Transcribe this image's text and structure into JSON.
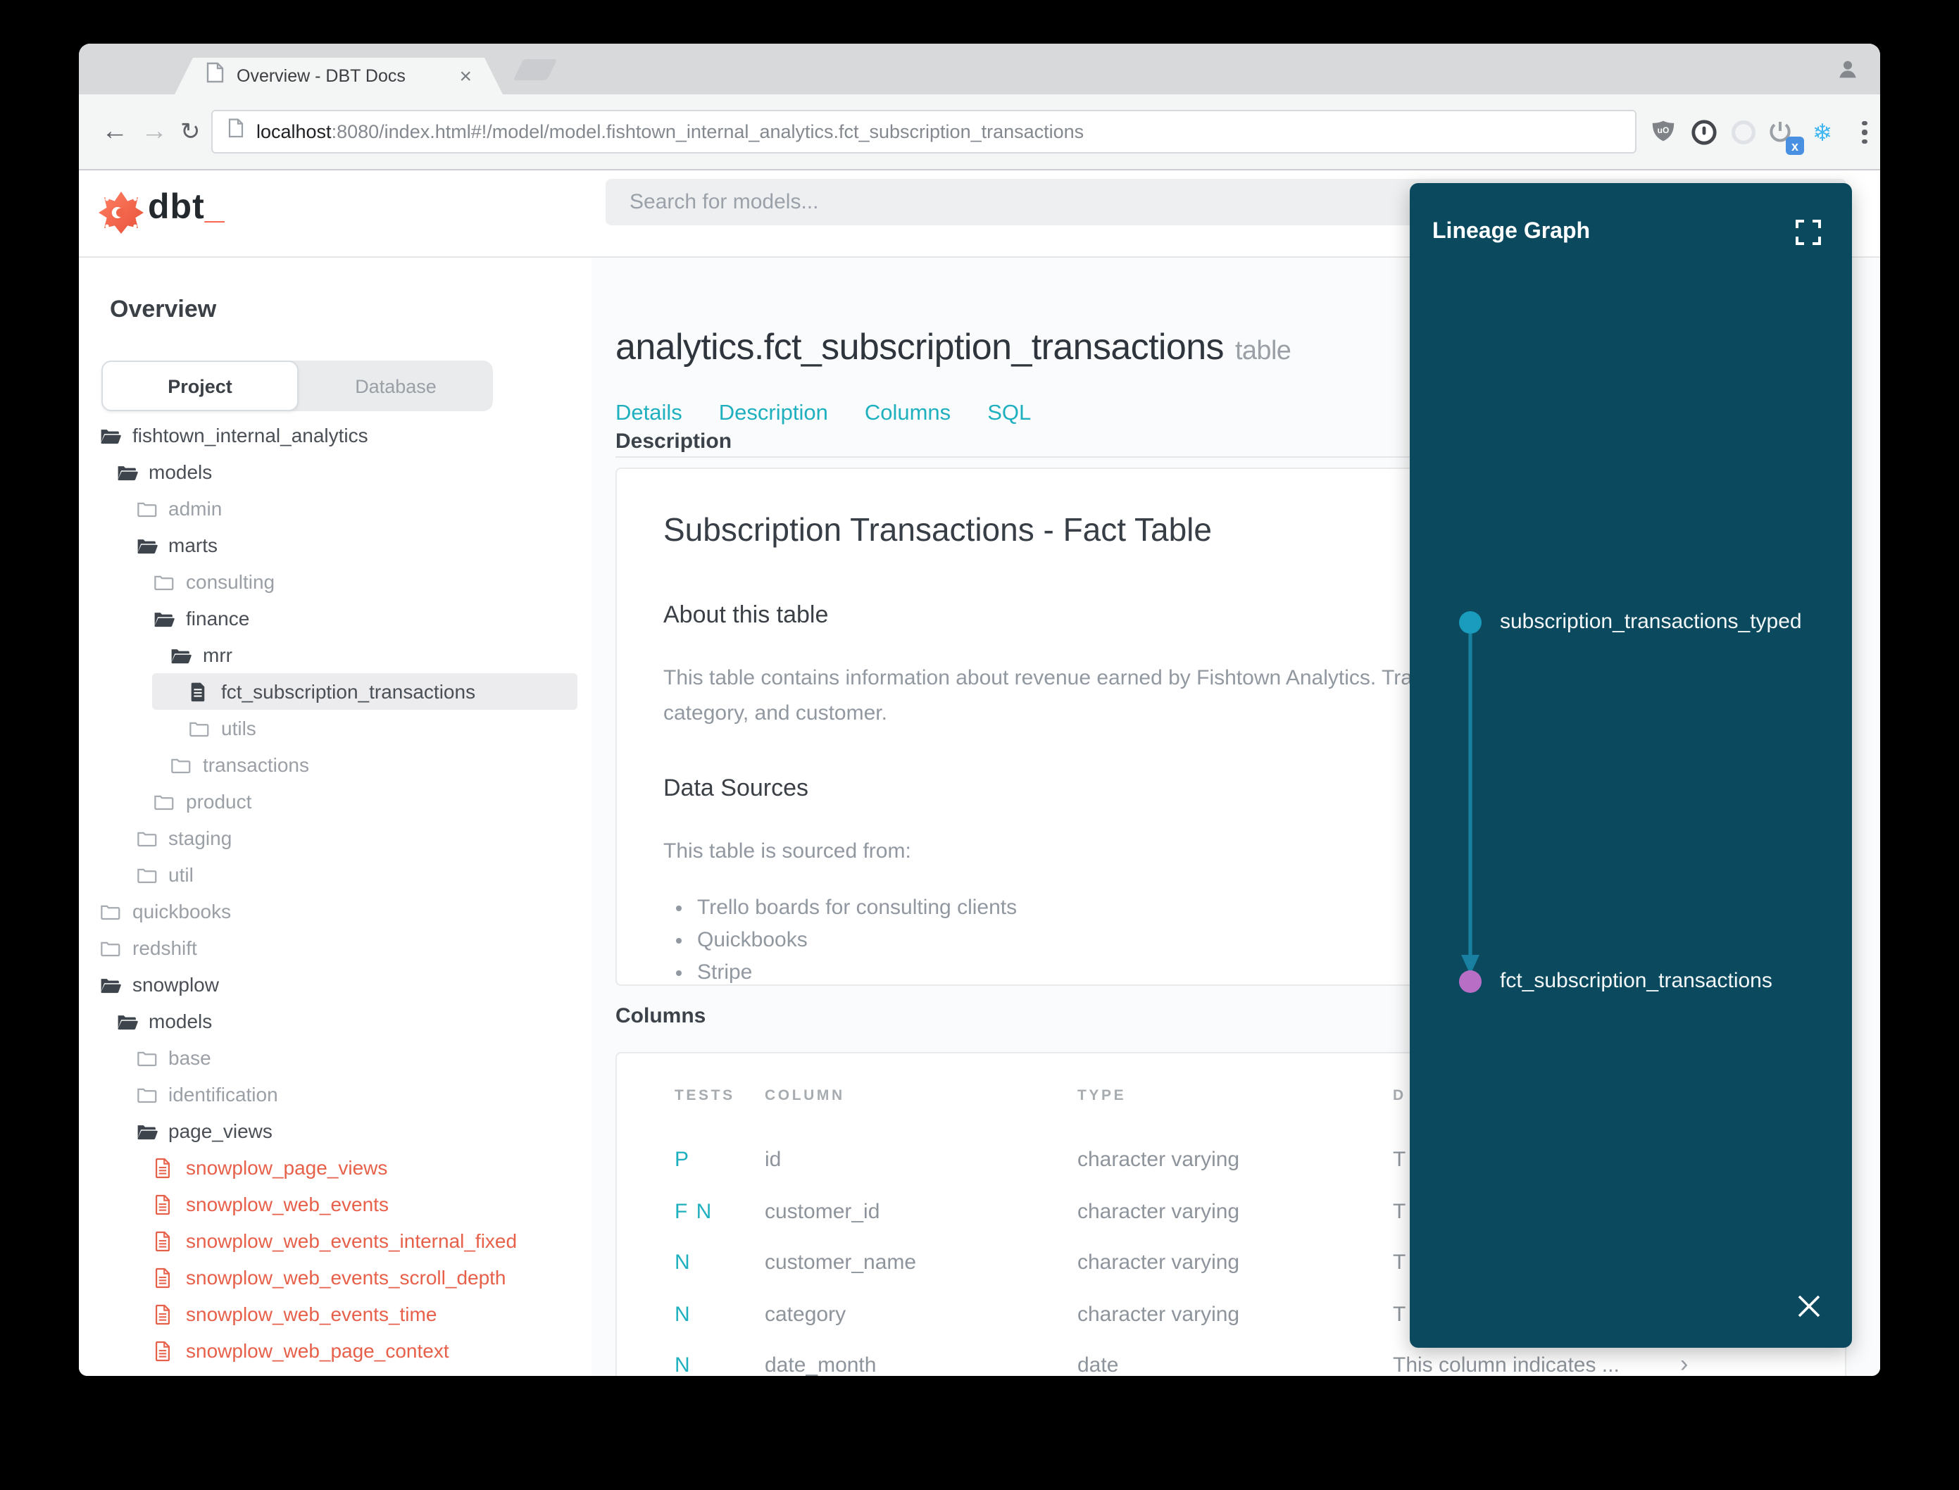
{
  "browser": {
    "tab_title": "Overview - DBT Docs",
    "tab_close": "×",
    "url_host": "localhost",
    "url_rest": ":8080/index.html#!/model/model.fishtown_internal_analytics.fct_subscription_transactions",
    "back_glyph": "←",
    "forward_glyph": "→",
    "reload_glyph": "↻",
    "snowflake_glyph": "❄",
    "extension_badge": "x"
  },
  "app_header": {
    "logo_text": "dbt",
    "logo_cursor": "_",
    "search_placeholder": "Search for models..."
  },
  "sidebar": {
    "heading": "Overview",
    "tabs": [
      {
        "label": "Project",
        "active": true
      },
      {
        "label": "Database",
        "active": false
      }
    ],
    "tree": [
      {
        "label": "fishtown_internal_analytics",
        "level": 0,
        "icon": "folder-open",
        "tone": "dark"
      },
      {
        "label": "models",
        "level": 1,
        "icon": "folder-open",
        "tone": "dark"
      },
      {
        "label": "admin",
        "level": 2,
        "icon": "folder",
        "tone": "gray"
      },
      {
        "label": "marts",
        "level": 2,
        "icon": "folder-open",
        "tone": "dark"
      },
      {
        "label": "consulting",
        "level": 3,
        "icon": "folder",
        "tone": "gray"
      },
      {
        "label": "finance",
        "level": 3,
        "icon": "folder-open",
        "tone": "dark"
      },
      {
        "label": "mrr",
        "level": 4,
        "icon": "folder-open",
        "tone": "dark"
      },
      {
        "label": "fct_subscription_transactions",
        "level": 5,
        "icon": "file-solid",
        "tone": "dark",
        "selected": true
      },
      {
        "label": "utils",
        "level": 5,
        "icon": "folder",
        "tone": "gray"
      },
      {
        "label": "transactions",
        "level": 4,
        "icon": "folder",
        "tone": "gray"
      },
      {
        "label": "product",
        "level": 3,
        "icon": "folder",
        "tone": "gray"
      },
      {
        "label": "staging",
        "level": 2,
        "icon": "folder",
        "tone": "gray"
      },
      {
        "label": "util",
        "level": 2,
        "icon": "folder",
        "tone": "gray"
      },
      {
        "label": "quickbooks",
        "level": 0,
        "icon": "folder",
        "tone": "gray"
      },
      {
        "label": "redshift",
        "level": 0,
        "icon": "folder",
        "tone": "gray"
      },
      {
        "label": "snowplow",
        "level": 0,
        "icon": "folder-open",
        "tone": "dark"
      },
      {
        "label": "models",
        "level": 1,
        "icon": "folder-open",
        "tone": "dark"
      },
      {
        "label": "base",
        "level": 2,
        "icon": "folder",
        "tone": "gray"
      },
      {
        "label": "identification",
        "level": 2,
        "icon": "folder",
        "tone": "gray"
      },
      {
        "label": "page_views",
        "level": 2,
        "icon": "folder-open",
        "tone": "dark"
      },
      {
        "label": "snowplow_page_views",
        "level": 3,
        "icon": "file-outline",
        "tone": "orange"
      },
      {
        "label": "snowplow_web_events",
        "level": 3,
        "icon": "file-outline",
        "tone": "orange"
      },
      {
        "label": "snowplow_web_events_internal_fixed",
        "level": 3,
        "icon": "file-outline",
        "tone": "orange"
      },
      {
        "label": "snowplow_web_events_scroll_depth",
        "level": 3,
        "icon": "file-outline",
        "tone": "orange"
      },
      {
        "label": "snowplow_web_events_time",
        "level": 3,
        "icon": "file-outline",
        "tone": "orange"
      },
      {
        "label": "snowplow_web_page_context",
        "level": 3,
        "icon": "file-outline",
        "tone": "orange"
      }
    ]
  },
  "main": {
    "title": "analytics.fct_subscription_transactions",
    "title_badge": "table",
    "tabs": [
      "Details",
      "Description",
      "Columns",
      "SQL"
    ],
    "description_section": {
      "label": "Description",
      "heading": "Subscription Transactions - Fact Table",
      "about_heading": "About this table",
      "about_lines": [
        "This table contains information about revenue earned by Fishtown Analytics. Trans",
        "category, and customer."
      ],
      "sources_heading": "Data Sources",
      "sources_intro": "This table is sourced from:",
      "sources": [
        "Trello boards for consulting clients",
        "Quickbooks",
        "Stripe"
      ]
    },
    "columns_section": {
      "label": "Columns",
      "headers": {
        "tests": "TESTS",
        "column": "COLUMN",
        "type": "TYPE",
        "description": "D"
      },
      "rows": [
        {
          "tests": "P",
          "column": "id",
          "type": "character varying",
          "description": "T"
        },
        {
          "tests": "F N",
          "column": "customer_id",
          "type": "character varying",
          "description": "T"
        },
        {
          "tests": "N",
          "column": "customer_name",
          "type": "character varying",
          "description": "T"
        },
        {
          "tests": "N",
          "column": "category",
          "type": "character varying",
          "description": "T"
        },
        {
          "tests": "N",
          "column": "date_month",
          "type": "date",
          "description": "This column indicates ...",
          "chevron": "›"
        }
      ]
    }
  },
  "lineage": {
    "title": "Lineage Graph",
    "nodes": [
      {
        "label": "subscription_transactions_typed",
        "color": "#199cbd"
      },
      {
        "label": "fct_subscription_transactions",
        "color": "#b86ec5"
      }
    ],
    "edge_color": "#1a80a2",
    "background": "#0b4a5e"
  },
  "colors": {
    "accent_teal": "#1fb0bf",
    "accent_orange": "#e7604a",
    "panel_bg": "#0b4a5e",
    "node_cyan": "#199cbd",
    "node_purple": "#b86ec5"
  }
}
